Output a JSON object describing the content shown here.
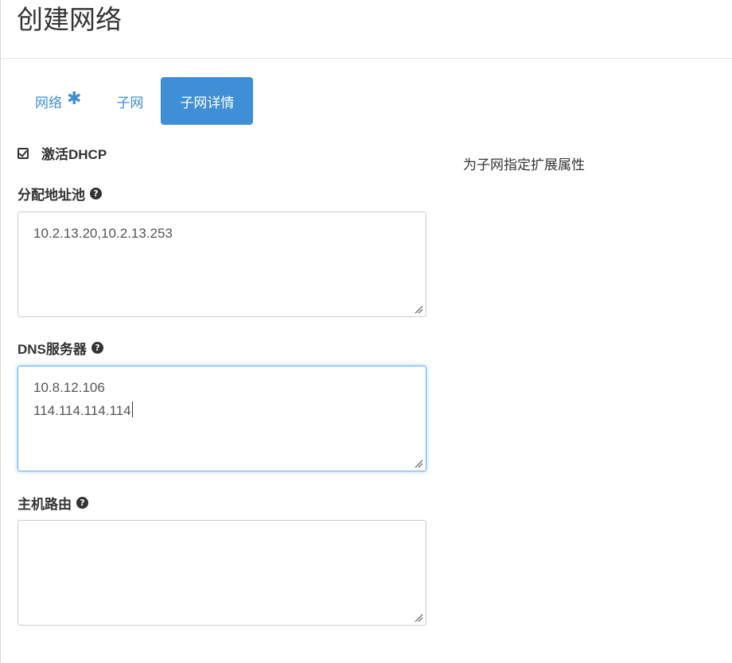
{
  "header": {
    "title": "创建网络"
  },
  "tabs": [
    {
      "label": "网络",
      "required_mark": "✱",
      "active": false
    },
    {
      "label": "子网",
      "active": false
    },
    {
      "label": "子网详情",
      "active": true
    }
  ],
  "dhcp": {
    "label": "激活DHCP",
    "checked": true
  },
  "side_help": "为子网指定扩展属性",
  "fields": {
    "allocation_pools": {
      "label": "分配地址池",
      "help_icon": "question-circle-icon",
      "value": "10.2.13.20,10.2.13.253"
    },
    "dns_servers": {
      "label": "DNS服务器",
      "help_icon": "question-circle-icon",
      "value_line1": "10.8.12.106",
      "value_line2": "114.114.114.114",
      "focused": true
    },
    "host_routes": {
      "label": "主机路由",
      "help_icon": "question-circle-icon",
      "value": ""
    }
  },
  "colors": {
    "accent": "#3f8fd6",
    "focus_border": "#66afe9",
    "text": "#333333"
  }
}
